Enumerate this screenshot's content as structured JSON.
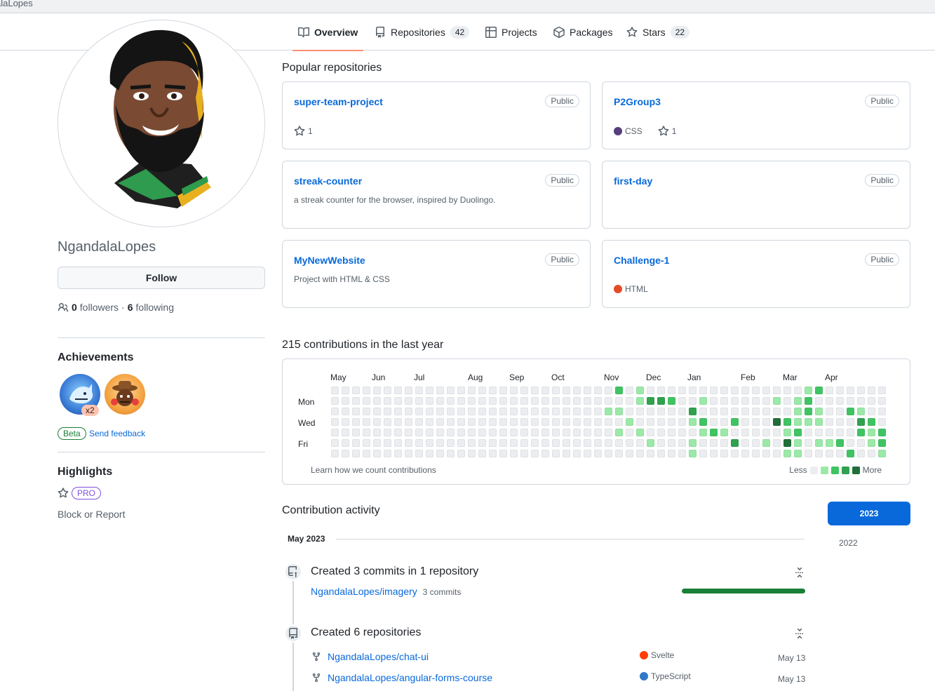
{
  "topbar": {
    "crumb": "alaLopes"
  },
  "tabs": [
    {
      "label": "Overview",
      "icon": "book-icon"
    },
    {
      "label": "Repositories",
      "count": "42",
      "icon": "repo-icon"
    },
    {
      "label": "Projects",
      "icon": "table-icon"
    },
    {
      "label": "Packages",
      "icon": "package-icon"
    },
    {
      "label": "Stars",
      "count": "22",
      "icon": "star-icon"
    }
  ],
  "profile": {
    "username": "NgandalaLopes",
    "follow_label": "Follow",
    "followers_count": "0",
    "followers_label": "followers",
    "separator": "·",
    "following_count": "6",
    "following_label": "following"
  },
  "achievements": {
    "title": "Achievements",
    "multiplier": "x2",
    "beta_label": "Beta",
    "feedback_label": "Send feedback"
  },
  "highlights": {
    "title": "Highlights",
    "pro_label": "PRO",
    "block_label": "Block or Report"
  },
  "popular": {
    "title": "Popular repositories",
    "repos": [
      {
        "name": "super-team-project",
        "visibility": "Public",
        "description": "",
        "language": "",
        "language_color": "",
        "stars": "1"
      },
      {
        "name": "P2Group3",
        "visibility": "Public",
        "description": "",
        "language": "CSS",
        "language_color": "#563d7c",
        "stars": "1"
      },
      {
        "name": "streak-counter",
        "visibility": "Public",
        "description": "a streak counter for the browser, inspired by Duolingo.",
        "language": "",
        "language_color": "",
        "stars": ""
      },
      {
        "name": "first-day",
        "visibility": "Public",
        "description": "",
        "language": "",
        "language_color": "",
        "stars": ""
      },
      {
        "name": "MyNewWebsite",
        "visibility": "Public",
        "description": "Project with HTML & CSS",
        "language": "",
        "language_color": "",
        "stars": ""
      },
      {
        "name": "Challenge-1",
        "visibility": "Public",
        "description": "",
        "language": "HTML",
        "language_color": "#e34c26",
        "stars": ""
      }
    ]
  },
  "contributions": {
    "title": "215 contributions in the last year",
    "months": [
      "May",
      "Jun",
      "Jul",
      "Aug",
      "Sep",
      "Oct",
      "Nov",
      "Dec",
      "Jan",
      "Feb",
      "Mar",
      "Apr"
    ],
    "day_labels": [
      "Mon",
      "Wed",
      "Fri"
    ],
    "learn_label": "Learn how we count contributions",
    "legend_less": "Less",
    "legend_more": "More",
    "level_colors": [
      "#ebedf0",
      "#9be9a8",
      "#40c463",
      "#30a14e",
      "#216e39"
    ],
    "active_cells": [
      [
        27,
        0,
        2
      ],
      [
        29,
        0,
        1
      ],
      [
        45,
        0,
        1
      ],
      [
        46,
        0,
        2
      ],
      [
        44,
        1,
        1
      ],
      [
        45,
        1,
        2
      ],
      [
        29,
        1,
        1
      ],
      [
        30,
        1,
        3
      ],
      [
        31,
        1,
        3
      ],
      [
        32,
        1,
        2
      ],
      [
        35,
        1,
        1
      ],
      [
        42,
        1,
        1
      ],
      [
        44,
        1,
        1
      ],
      [
        26,
        2,
        1
      ],
      [
        27,
        2,
        1
      ],
      [
        34,
        2,
        3
      ],
      [
        44,
        2,
        1
      ],
      [
        45,
        2,
        2
      ],
      [
        46,
        2,
        1
      ],
      [
        49,
        2,
        2
      ],
      [
        50,
        2,
        1
      ],
      [
        28,
        3,
        1
      ],
      [
        34,
        3,
        1
      ],
      [
        35,
        3,
        2
      ],
      [
        38,
        3,
        2
      ],
      [
        42,
        3,
        4
      ],
      [
        43,
        3,
        2
      ],
      [
        44,
        3,
        1
      ],
      [
        45,
        3,
        1
      ],
      [
        46,
        3,
        1
      ],
      [
        50,
        3,
        3
      ],
      [
        51,
        3,
        2
      ],
      [
        27,
        4,
        1
      ],
      [
        29,
        4,
        1
      ],
      [
        35,
        4,
        1
      ],
      [
        36,
        4,
        2
      ],
      [
        37,
        4,
        1
      ],
      [
        43,
        4,
        1
      ],
      [
        44,
        4,
        2
      ],
      [
        50,
        4,
        2
      ],
      [
        51,
        4,
        1
      ],
      [
        52,
        4,
        2
      ],
      [
        30,
        5,
        1
      ],
      [
        34,
        5,
        1
      ],
      [
        38,
        5,
        3
      ],
      [
        41,
        5,
        1
      ],
      [
        43,
        5,
        4
      ],
      [
        44,
        5,
        1
      ],
      [
        46,
        5,
        1
      ],
      [
        47,
        5,
        1
      ],
      [
        48,
        5,
        2
      ],
      [
        51,
        5,
        1
      ],
      [
        52,
        5,
        2
      ],
      [
        34,
        6,
        1
      ],
      [
        43,
        6,
        1
      ],
      [
        44,
        6,
        1
      ],
      [
        49,
        6,
        2
      ],
      [
        52,
        6,
        1
      ]
    ]
  },
  "activity": {
    "title": "Contribution activity",
    "month_label": "May 2023",
    "years": [
      "2023",
      "2022"
    ],
    "commits_event": {
      "title": "Created 3 commits in 1 repository",
      "repo": "NgandalaLopes/imagery",
      "count_label": "3 commits",
      "share": 1.0
    },
    "repos_event": {
      "title": "Created 6 repositories",
      "items": [
        {
          "repo": "NgandalaLopes/chat-ui",
          "language": "Svelte",
          "language_color": "#ff3e00",
          "date": "May 13"
        },
        {
          "repo": "NgandalaLopes/angular-forms-course",
          "language": "TypeScript",
          "language_color": "#3178c6",
          "date": "May 13"
        }
      ]
    }
  }
}
